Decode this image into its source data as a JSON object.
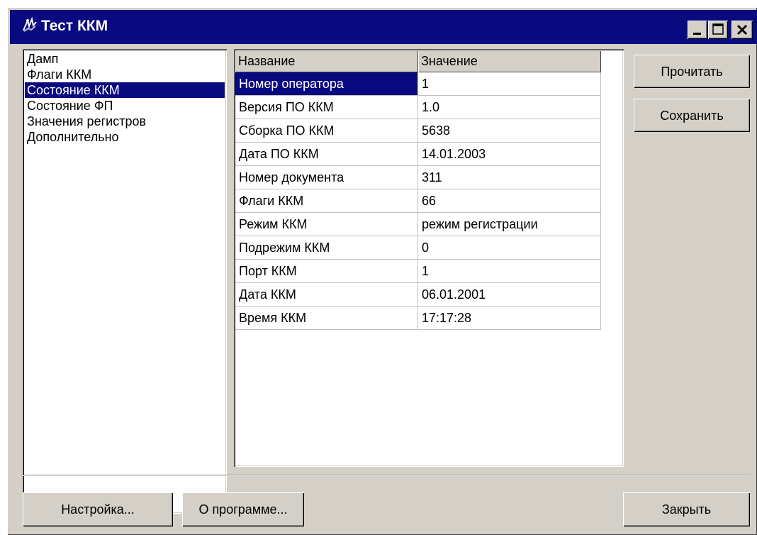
{
  "window": {
    "title": "Тест ККМ",
    "controls": {
      "minimize": "minimize-icon",
      "maximize": "maximize-icon",
      "close": "close-icon"
    }
  },
  "sidebar": {
    "items": [
      {
        "label": "Дамп",
        "selected": false
      },
      {
        "label": "Флаги ККМ",
        "selected": false
      },
      {
        "label": "Состояние ККМ",
        "selected": true
      },
      {
        "label": "Состояние ФП",
        "selected": false
      },
      {
        "label": "Значения регистров",
        "selected": false
      },
      {
        "label": "Дополнительно",
        "selected": false
      }
    ]
  },
  "table": {
    "columns": [
      "Название",
      "Значение"
    ],
    "rows": [
      [
        "Номер оператора",
        "1"
      ],
      [
        "Версия ПО ККМ",
        "1.0"
      ],
      [
        "Сборка ПО ККМ",
        "5638"
      ],
      [
        "Дата ПО ККМ",
        "14.01.2003"
      ],
      [
        "Номер документа",
        "311"
      ],
      [
        "Флаги ККМ",
        "66"
      ],
      [
        "Режим ККМ",
        "режим регистрации"
      ],
      [
        "Подрежим ККМ",
        "0"
      ],
      [
        "Порт ККМ",
        "1"
      ],
      [
        "Дата ККМ",
        "06.01.2001"
      ],
      [
        "Время ККМ",
        "17:17:28"
      ]
    ],
    "selected_row": 0
  },
  "buttons": {
    "read": "Прочитать",
    "save": "Сохранить",
    "settings": "Настройка...",
    "about": "О программе...",
    "close": "Закрыть"
  },
  "colors": {
    "titlebar": "#0a0a80",
    "face": "#d4d0c8",
    "selection": "#0a0a80"
  }
}
